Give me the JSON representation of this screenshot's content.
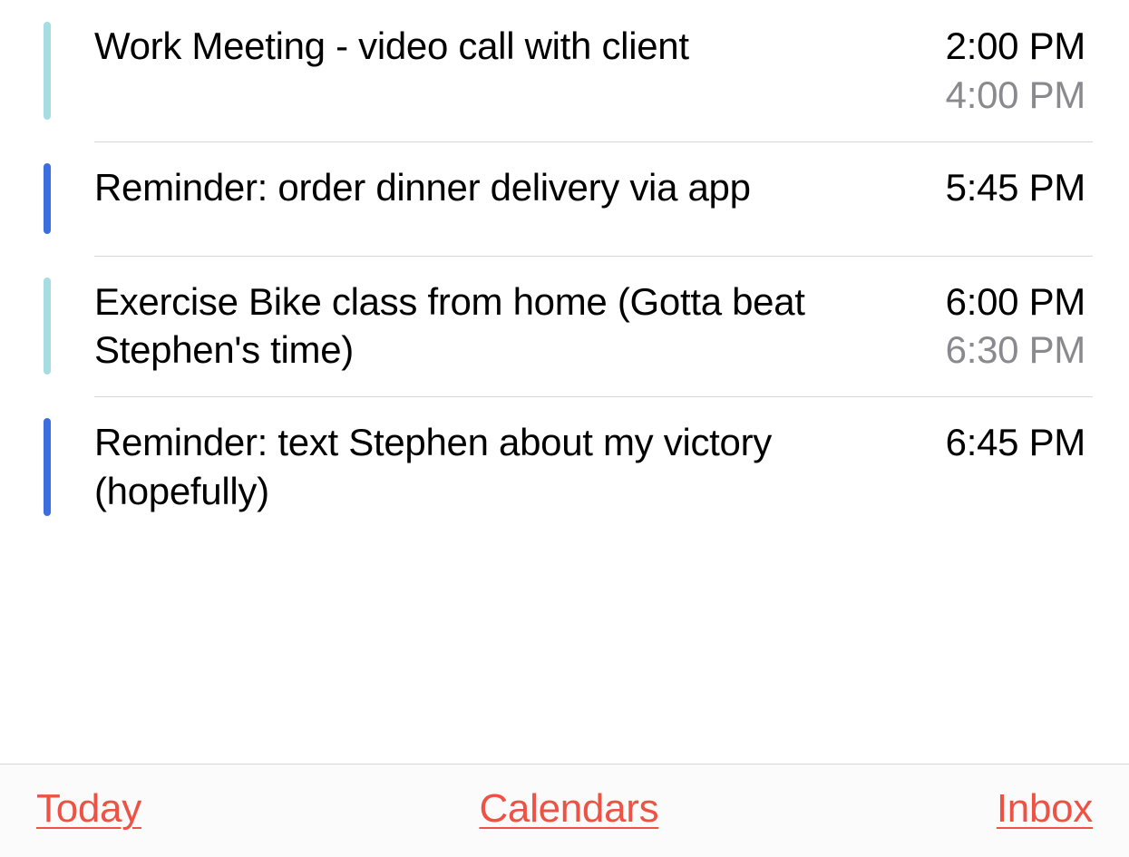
{
  "calendar_colors": {
    "work": "#a6dde2",
    "reminder": "#3b6fe0"
  },
  "events": [
    {
      "title": "Work Meeting - video call with client",
      "start_time": "2:00 PM",
      "end_time": "4:00 PM",
      "color_key": "work"
    },
    {
      "title": "Reminder: order dinner delivery via app",
      "start_time": "5:45 PM",
      "end_time": null,
      "color_key": "reminder"
    },
    {
      "title": "Exercise Bike class from home (Gotta beat Stephen's time)",
      "start_time": "6:00 PM",
      "end_time": "6:30 PM",
      "color_key": "work"
    },
    {
      "title": "Reminder: text Stephen about my victory (hopefully)",
      "start_time": "6:45 PM",
      "end_time": null,
      "color_key": "reminder"
    }
  ],
  "toolbar": {
    "today_label": "Today",
    "calendars_label": "Calendars",
    "inbox_label": "Inbox"
  }
}
